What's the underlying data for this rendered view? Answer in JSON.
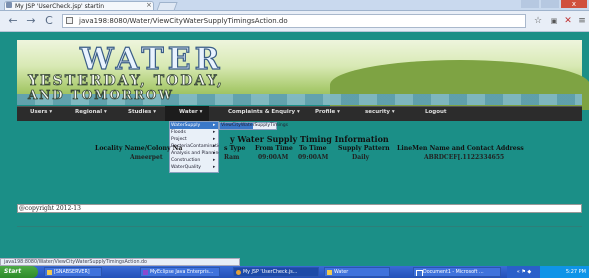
{
  "browser": {
    "tab_title": "My JSP 'UserCheck.jsp' startin",
    "tab_close": "×",
    "url": "java198:8080/Water/ViewCityWaterSupplyTimingsAction.do",
    "back_glyph": "←",
    "forward_glyph": "→",
    "reload_glyph": "C",
    "star_glyph": "☆",
    "close_glyph": "x"
  },
  "header": {
    "logo": "WATER",
    "line1": "YESTERDAY, TODAY,",
    "line2": "AND TOMORROW"
  },
  "menu": [
    {
      "label": "Users ▾"
    },
    {
      "label": "Regional ▾"
    },
    {
      "label": "Studies ▾"
    },
    {
      "label": "Water ▾"
    },
    {
      "label": "Complaints & Enquiry ▾"
    },
    {
      "label": "Profile ▾"
    },
    {
      "label": "security ▾"
    },
    {
      "label": "Logout"
    }
  ],
  "water_dropdown": [
    {
      "label": "WaterSupply"
    },
    {
      "label": "Floods"
    },
    {
      "label": "Project"
    },
    {
      "label": "BacteriaContamination"
    },
    {
      "label": "Analysis and Planning"
    },
    {
      "label": "Construction"
    },
    {
      "label": "WaterQuality"
    }
  ],
  "submenu": {
    "label": "ViewCityWaterSupplyTimings"
  },
  "table": {
    "title": "y Water Supply Timing Information",
    "headers": [
      "Locality Name/Colony Na",
      "s Type",
      "From Time",
      "To Time",
      "Supply Pattern",
      "LineMen Name and Contact Address"
    ],
    "row": [
      "Ameerpet",
      "Ram",
      "09:00AM",
      "09:00AM",
      "Daily",
      "ABRDCEF[.1122334655"
    ]
  },
  "footer": {
    "copyright": "@copyright 2012-13"
  },
  "status_url": "java198:8080/Water/ViewCityWaterSupplyTimingsAction.do",
  "taskbar": {
    "start": "Start",
    "tasks": [
      {
        "label": "[SNABSERVER]"
      },
      {
        "label": "MyEclipse Java Enterpris..."
      },
      {
        "label": "My JSP 'UserCheck.js..."
      },
      {
        "label": "Water"
      },
      {
        "label": "Document1 - Microsoft ..."
      }
    ],
    "clock": "5:27 PM"
  },
  "colors": {
    "page_bg": "#1b8f87",
    "menu_bg": "#2c2c2c",
    "accent": "#3a78c8"
  }
}
